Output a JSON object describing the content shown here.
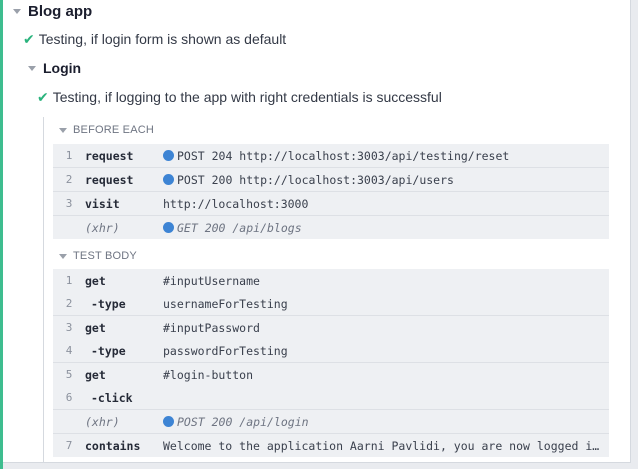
{
  "suite": {
    "title": "Blog app",
    "tests": [
      {
        "title": "Testing, if login form is shown as default"
      }
    ],
    "subsuite": {
      "title": "Login",
      "test": {
        "title": "Testing, if logging to the app with right credentials is successful",
        "before_each": {
          "label": "BEFORE EACH",
          "commands": [
            {
              "num": "1",
              "name": "request",
              "msg": "POST 204 http://localhost:3003/api/testing/reset"
            },
            {
              "num": "2",
              "name": "request",
              "msg": "POST 200 http://localhost:3003/api/users"
            },
            {
              "num": "3",
              "name": "visit",
              "msg": "http://localhost:3000"
            },
            {
              "num": "",
              "name": "(xhr)",
              "msg": "GET 200 /api/blogs"
            }
          ]
        },
        "test_body": {
          "label": "TEST BODY",
          "commands": [
            {
              "num": "1",
              "name": "get",
              "msg": "#inputUsername"
            },
            {
              "num": "2",
              "name": "-type",
              "msg": "usernameForTesting"
            },
            {
              "num": "3",
              "name": "get",
              "msg": "#inputPassword"
            },
            {
              "num": "4",
              "name": "-type",
              "msg": "passwordForTesting"
            },
            {
              "num": "5",
              "name": "get",
              "msg": "#login-button"
            },
            {
              "num": "6",
              "name": "-click",
              "msg": ""
            },
            {
              "num": "",
              "name": "(xhr)",
              "msg": "POST 200 /api/login"
            },
            {
              "num": "7",
              "name": "contains",
              "msg": "Welcome to the application Aarni Pavlidi, you are now logged in to the application"
            }
          ]
        }
      }
    }
  },
  "colors": {
    "accent": "#3ebd8f",
    "pass": "#2ab37d",
    "request_dot": "#3d84d4"
  },
  "icons": {
    "caret": "caret-down-icon",
    "pass": "check-icon",
    "request": "request-dot-icon"
  }
}
